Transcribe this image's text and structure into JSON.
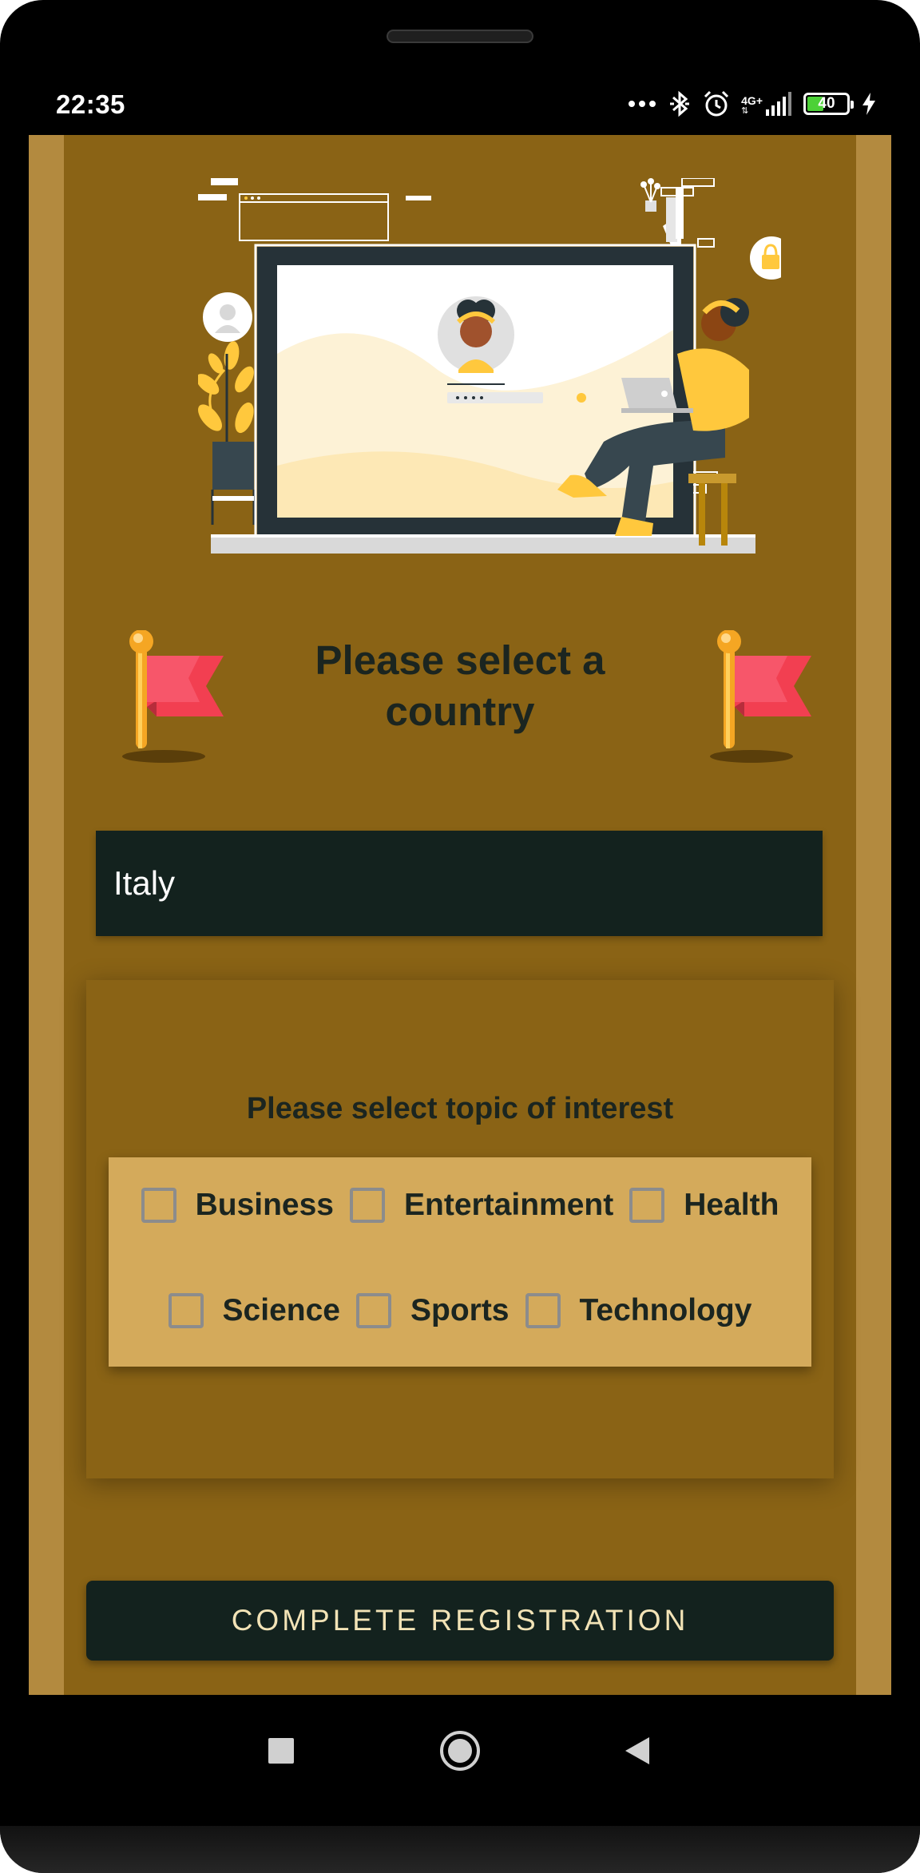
{
  "status_bar": {
    "time": "22:35",
    "network": "4G+",
    "battery_level": "40",
    "icons": [
      "more-dots-icon",
      "bluetooth-icon",
      "alarm-clock-icon",
      "signal-icon",
      "battery-icon",
      "charging-bolt-icon"
    ]
  },
  "page": {
    "title": "Please select a country",
    "hero_illustration": "login-illustration",
    "flag_icons": [
      "red-flag-icon",
      "red-flag-icon"
    ]
  },
  "country_select": {
    "value": "Italy"
  },
  "topics": {
    "title": "Please select topic of interest",
    "row1": [
      {
        "label": "Business",
        "checked": false
      },
      {
        "label": "Entertainment",
        "checked": false
      },
      {
        "label": "Health",
        "checked": false
      }
    ],
    "row2": [
      {
        "label": "Science",
        "checked": false
      },
      {
        "label": "Sports",
        "checked": false
      },
      {
        "label": "Technology",
        "checked": false
      }
    ]
  },
  "complete_button": {
    "label": "COMPLETE REGISTRATION"
  },
  "nav_bar": {
    "buttons": [
      "recents-square-icon",
      "home-circle-icon",
      "back-triangle-icon"
    ]
  },
  "colors": {
    "screen_border": "#b38a3f",
    "background": "#8a6315",
    "dark": "#13221e",
    "panel": "#d4aa5b",
    "title_text": "#1b2520",
    "flag_red": "#f23f51",
    "button_text": "#f2e3b6"
  }
}
